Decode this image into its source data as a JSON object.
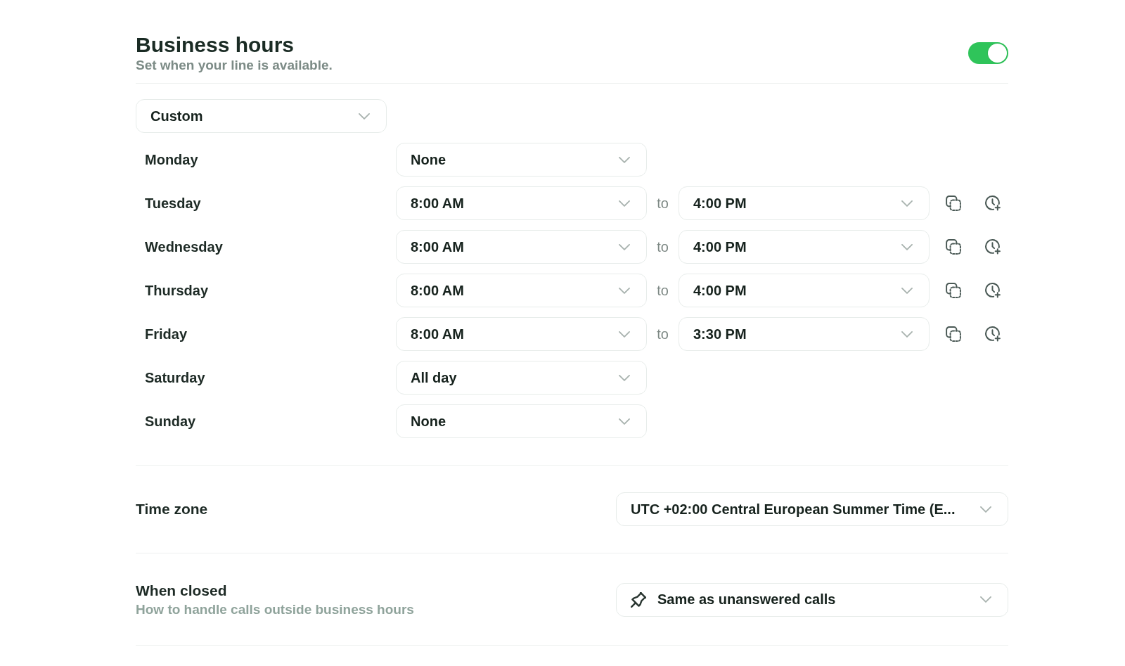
{
  "header": {
    "title": "Business hours",
    "subtitle": "Set when your line is available.",
    "enabled": true
  },
  "schedule_preset": {
    "value": "Custom"
  },
  "days": [
    {
      "day": "Monday",
      "kind": "single",
      "value": "None"
    },
    {
      "day": "Tuesday",
      "kind": "range",
      "from": "8:00 AM",
      "separator": "to",
      "to": "4:00 PM"
    },
    {
      "day": "Wednesday",
      "kind": "range",
      "from": "8:00 AM",
      "separator": "to",
      "to": "4:00 PM"
    },
    {
      "day": "Thursday",
      "kind": "range",
      "from": "8:00 AM",
      "separator": "to",
      "to": "4:00 PM"
    },
    {
      "day": "Friday",
      "kind": "range",
      "from": "8:00 AM",
      "separator": "to",
      "to": "3:30 PM"
    },
    {
      "day": "Saturday",
      "kind": "single",
      "value": "All day"
    },
    {
      "day": "Sunday",
      "kind": "single",
      "value": "None"
    }
  ],
  "time_zone": {
    "label": "Time zone",
    "value": "UTC +02:00 Central European Summer Time (E..."
  },
  "when_closed": {
    "label": "When closed",
    "description": "How to handle calls outside business hours",
    "value": "Same as unanswered calls"
  }
}
